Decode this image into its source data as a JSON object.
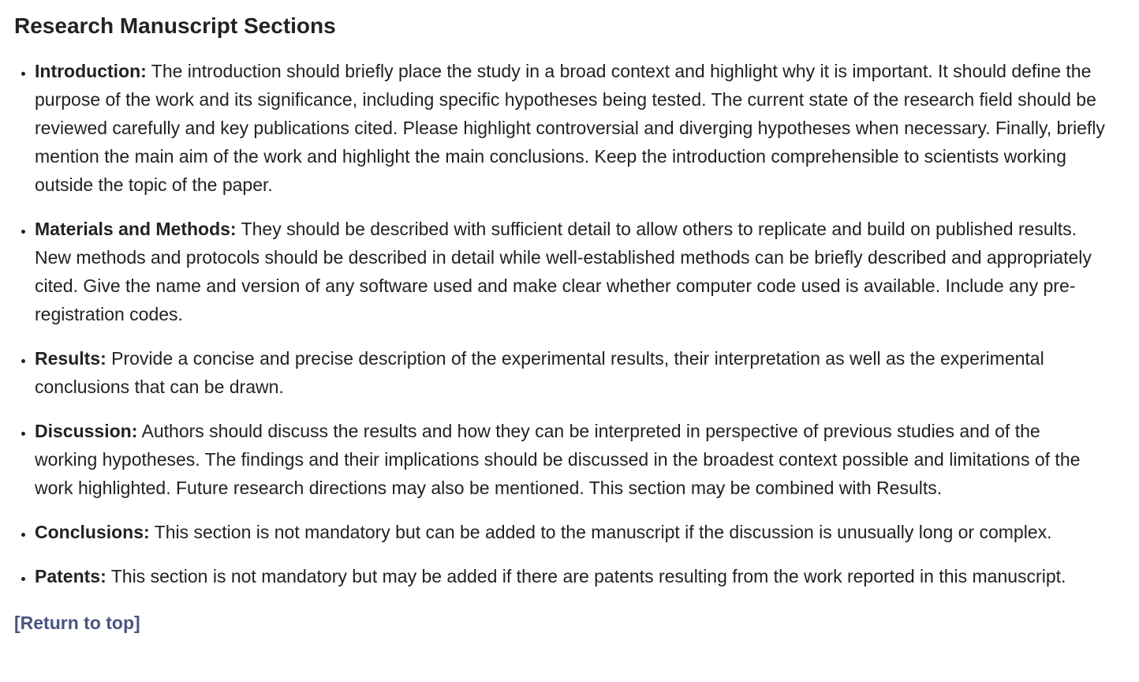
{
  "page": {
    "title": "Research Manuscript Sections",
    "return_link": "[Return to top]"
  },
  "sections": [
    {
      "term": "Introduction:",
      "text": "The introduction should briefly place the study in a broad context and highlight why it is important. It should define the purpose of the work and its significance, including specific hypotheses being tested. The current state of the research field should be reviewed carefully and key publications cited. Please highlight controversial and diverging hypotheses when necessary. Finally, briefly mention the main aim of the work and highlight the main conclusions. Keep the introduction comprehensible to scientists working outside the topic of the paper."
    },
    {
      "term": "Materials and Methods:",
      "text": "They should be described with sufficient detail to allow others to replicate and build on published results. New methods and protocols should be described in detail while well-established methods can be briefly described and appropriately cited. Give the name and version of any software used and make clear whether computer code used is available. Include any pre-registration codes."
    },
    {
      "term": "Results:",
      "text": "Provide a concise and precise description of the experimental results, their interpretation as well as the experimental conclusions that can be drawn."
    },
    {
      "term": "Discussion:",
      "text": "Authors should discuss the results and how they can be interpreted in perspective of previous studies and of the working hypotheses. The findings and their implications should be discussed in the broadest context possible and limitations of the work highlighted. Future research directions may also be mentioned. This section may be combined with Results."
    },
    {
      "term": "Conclusions:",
      "text": "This section is not mandatory but can be added to the manuscript if the discussion is unusually long or complex."
    },
    {
      "term": "Patents:",
      "text": "This section is not mandatory but may be added if there are patents resulting from the work reported in this manuscript."
    }
  ],
  "colors": {
    "text": "#222222",
    "link": "#4a5480",
    "background": "#ffffff"
  }
}
